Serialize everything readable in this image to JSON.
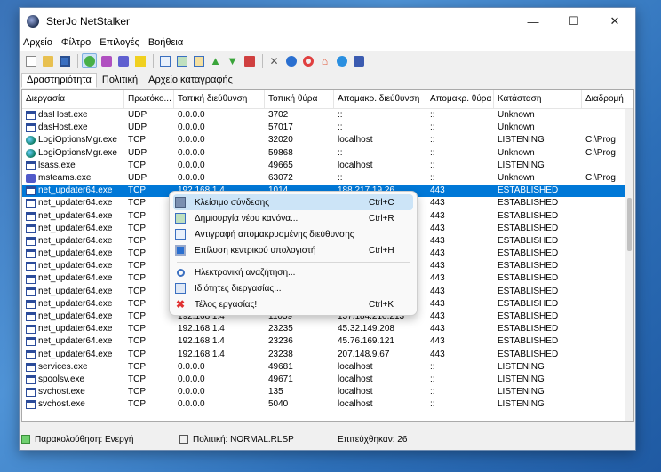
{
  "window": {
    "title": "SterJo NetStalker"
  },
  "window_controls": {
    "minimize": "—",
    "maximize": "☐",
    "close": "✕"
  },
  "menu": [
    "Αρχείο",
    "Φίλτρο",
    "Επιλογές",
    "Βοήθεια"
  ],
  "tabs": [
    "Δραστηριότητα",
    "Πολιτική",
    "Αρχείο καταγραφής"
  ],
  "columns": [
    "Διεργασία",
    "Πρωτόκο...",
    "Τοπική διεύθυνση",
    "Τοπική θύρα",
    "Απομακρ. διεύθυνση",
    "Απομακρ. θύρα",
    "Κατάσταση",
    "Διαδρομή"
  ],
  "rows": [
    [
      "dasHost.exe",
      "UDP",
      "0.0.0.0",
      "3702",
      "::",
      "::",
      "Unknown",
      ""
    ],
    [
      "dasHost.exe",
      "UDP",
      "0.0.0.0",
      "57017",
      "::",
      "::",
      "Unknown",
      ""
    ],
    [
      "LogiOptionsMgr.exe",
      "TCP",
      "0.0.0.0",
      "32020",
      "localhost",
      "::",
      "LISTENING",
      "C:\\Prog"
    ],
    [
      "LogiOptionsMgr.exe",
      "UDP",
      "0.0.0.0",
      "59868",
      "::",
      "::",
      "Unknown",
      "C:\\Prog"
    ],
    [
      "lsass.exe",
      "TCP",
      "0.0.0.0",
      "49665",
      "localhost",
      "::",
      "LISTENING",
      ""
    ],
    [
      "msteams.exe",
      "UDP",
      "0.0.0.0",
      "63072",
      "::",
      "::",
      "Unknown",
      "C:\\Prog"
    ],
    [
      "net_updater64.exe",
      "TCP",
      "192.168.1.4",
      "1014",
      "188.217.19.26",
      "443",
      "ESTABLISHED",
      ""
    ],
    [
      "net_updater64.exe",
      "TCP",
      "",
      "",
      "",
      "443",
      "ESTABLISHED",
      ""
    ],
    [
      "net_updater64.exe",
      "TCP",
      "",
      "",
      "",
      "443",
      "ESTABLISHED",
      ""
    ],
    [
      "net_updater64.exe",
      "TCP",
      "",
      "",
      "",
      "443",
      "ESTABLISHED",
      ""
    ],
    [
      "net_updater64.exe",
      "TCP",
      "",
      "",
      "",
      "443",
      "ESTABLISHED",
      ""
    ],
    [
      "net_updater64.exe",
      "TCP",
      "",
      "",
      "",
      "443",
      "ESTABLISHED",
      ""
    ],
    [
      "net_updater64.exe",
      "TCP",
      "",
      "",
      "",
      "443",
      "ESTABLISHED",
      ""
    ],
    [
      "net_updater64.exe",
      "TCP",
      "",
      "",
      "",
      "443",
      "ESTABLISHED",
      ""
    ],
    [
      "net_updater64.exe",
      "TCP",
      "",
      "",
      "",
      "443",
      "ESTABLISHED",
      ""
    ],
    [
      "net_updater64.exe",
      "TCP",
      "",
      "",
      "",
      "443",
      "ESTABLISHED",
      ""
    ],
    [
      "net_updater64.exe",
      "TCP",
      "192.168.1.4",
      "11059",
      "137.184.210.213",
      "443",
      "ESTABLISHED",
      ""
    ],
    [
      "net_updater64.exe",
      "TCP",
      "192.168.1.4",
      "23235",
      "45.32.149.208",
      "443",
      "ESTABLISHED",
      ""
    ],
    [
      "net_updater64.exe",
      "TCP",
      "192.168.1.4",
      "23236",
      "45.76.169.121",
      "443",
      "ESTABLISHED",
      ""
    ],
    [
      "net_updater64.exe",
      "TCP",
      "192.168.1.4",
      "23238",
      "207.148.9.67",
      "443",
      "ESTABLISHED",
      ""
    ],
    [
      "services.exe",
      "TCP",
      "0.0.0.0",
      "49681",
      "localhost",
      "::",
      "LISTENING",
      ""
    ],
    [
      "spoolsv.exe",
      "TCP",
      "0.0.0.0",
      "49671",
      "localhost",
      "::",
      "LISTENING",
      ""
    ],
    [
      "svchost.exe",
      "TCP",
      "0.0.0.0",
      "135",
      "localhost",
      "::",
      "LISTENING",
      ""
    ],
    [
      "svchost.exe",
      "TCP",
      "0.0.0.0",
      "5040",
      "localhost",
      "::",
      "LISTENING",
      ""
    ]
  ],
  "selected_row": 6,
  "context_menu": [
    {
      "label": "Κλείσιμο σύνδεσης",
      "shortcut": "Ctrl+C",
      "icon": "disconnect-icon"
    },
    {
      "label": "Δημιουργία νέου κανόνα...",
      "shortcut": "Ctrl+R",
      "icon": "new-rule-icon"
    },
    {
      "label": "Αντιγραφή απομακρυσμένης διεύθυνσης",
      "shortcut": "",
      "icon": "copy-icon"
    },
    {
      "label": "Επίλυση κεντρικού υπολογιστή",
      "shortcut": "Ctrl+H",
      "icon": "resolve-host-icon"
    },
    {
      "label": "Ηλεκτρονική αναζήτηση...",
      "shortcut": "",
      "icon": "search-icon"
    },
    {
      "label": "Ιδιότητες διεργασίας...",
      "shortcut": "",
      "icon": "properties-icon"
    },
    {
      "label": "Τέλος εργασίας!",
      "shortcut": "Ctrl+K",
      "icon": "end-task-icon"
    }
  ],
  "status": {
    "monitoring": "Παρακολούθηση: Ενεργή",
    "policy": "Πολιτική: NORMAL.RLSP",
    "success": "Επιτεύχθηκαν: 26"
  },
  "colors": {
    "selection": "#0078d7",
    "menu_highlight": "#cce4f7",
    "desktop": "#3a7cc4"
  }
}
